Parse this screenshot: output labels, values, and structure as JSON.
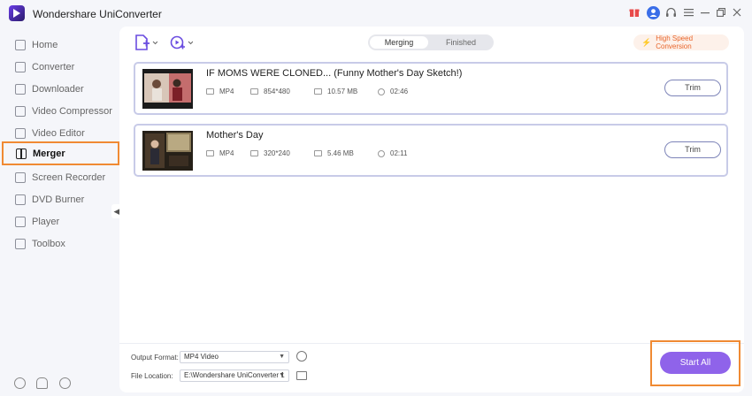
{
  "app": {
    "title": "Wondershare UniConverter"
  },
  "window_controls": [
    "gift-icon",
    "user-icon",
    "headset-icon",
    "menu-icon",
    "minimize-icon",
    "maximize-icon",
    "close-icon"
  ],
  "sidebar": {
    "items": [
      {
        "label": "Home",
        "icon": "home-icon"
      },
      {
        "label": "Converter",
        "icon": "converter-icon"
      },
      {
        "label": "Downloader",
        "icon": "downloader-icon"
      },
      {
        "label": "Video Compressor",
        "icon": "compressor-icon"
      },
      {
        "label": "Video Editor",
        "icon": "editor-icon"
      },
      {
        "label": "Merger",
        "icon": "merger-icon",
        "active": true
      },
      {
        "label": "Screen Recorder",
        "icon": "recorder-icon"
      },
      {
        "label": "DVD Burner",
        "icon": "dvd-icon"
      },
      {
        "label": "Player",
        "icon": "player-icon"
      },
      {
        "label": "Toolbox",
        "icon": "toolbox-icon"
      }
    ],
    "bottom_icons": [
      "help-icon",
      "bell-icon",
      "feedback-icon"
    ]
  },
  "toolbar": {
    "tabs": [
      {
        "label": "Merging",
        "active": true
      },
      {
        "label": "Finished"
      }
    ],
    "high_speed": "High Speed Conversion"
  },
  "files": [
    {
      "title": "IF MOMS WERE CLONED... (Funny Mother's Day Sketch!)",
      "format": "MP4",
      "resolution": "854*480",
      "size": "10.57 MB",
      "duration": "02:46",
      "trim": "Trim"
    },
    {
      "title": "Mother's Day",
      "format": "MP4",
      "resolution": "320*240",
      "size": "5.46 MB",
      "duration": "02:11",
      "trim": "Trim"
    }
  ],
  "footer": {
    "output_format_label": "Output Format:",
    "output_format_value": "MP4 Video",
    "file_location_label": "File Location:",
    "file_location_value": "E:\\Wondershare UniConverter 1",
    "start_all": "Start All"
  },
  "colors": {
    "accent": "#8f63ea",
    "highlight": "#f08a33",
    "orange_text": "#e8652b"
  }
}
